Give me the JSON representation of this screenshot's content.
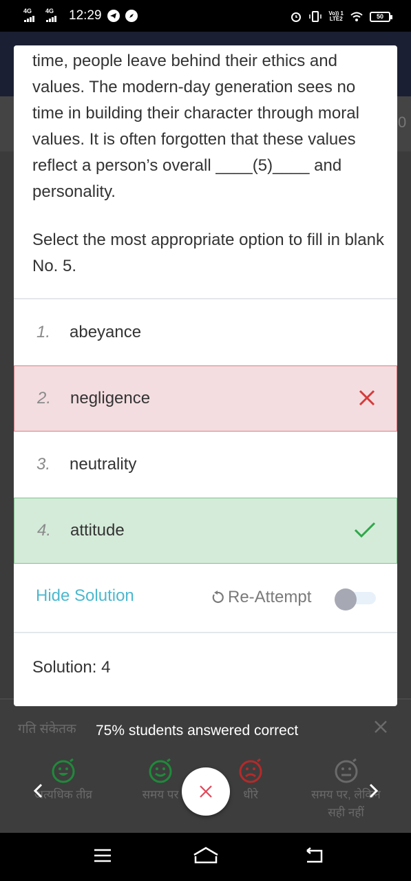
{
  "status_bar": {
    "network1": "4G",
    "network2": "4G",
    "time": "12:29",
    "lte_line1": "Vo)) 1",
    "lte_line2": "LTE2",
    "battery": "50"
  },
  "background": {
    "partial_number": "0",
    "speed_title": "गति संकेतक",
    "speed_options": [
      {
        "label": "अत्यधिक तीव्र",
        "color": "#1f8a3a"
      },
      {
        "label": "समय पर",
        "color": "#1f8a3a"
      },
      {
        "label": "धीरे",
        "color": "#b52a2a"
      },
      {
        "label": "समय पर, लेकिन सही नहीं",
        "color": "#6a6a6a"
      }
    ]
  },
  "modal": {
    "passage": "time, people leave behind their ethics and values. The modern-day generation sees no time in building their character through moral values. It is often forgotten that these values reflect a person’s overall ____(5)____ and personality.",
    "question": "Select the most appropriate option to fill in blank No. 5.",
    "options": [
      {
        "number": "1.",
        "text": "abeyance",
        "state": "neutral"
      },
      {
        "number": "2.",
        "text": "negligence",
        "state": "wrong"
      },
      {
        "number": "3.",
        "text": "neutrality",
        "state": "neutral"
      },
      {
        "number": "4.",
        "text": "attitude",
        "state": "correct"
      }
    ],
    "hide_solution_label": "Hide Solution",
    "reattempt_label": "Re-Attempt",
    "reattempt_toggle_on": false,
    "solution_text": "Solution: 4"
  },
  "toast": "75% students answered correct",
  "colors": {
    "accent": "#4cb8cf",
    "wrong_bg": "#f3dde0",
    "wrong_border": "#e27a7e",
    "wrong_mark": "#d63a3a",
    "correct_bg": "#d5ebd9",
    "correct_border": "#7cc48d",
    "correct_mark": "#2ea84a"
  },
  "icons": {
    "wrong_mark": "close-icon",
    "correct_mark": "check-icon",
    "reattempt": "refresh-icon",
    "fab": "close-icon",
    "prev": "chevron-left-icon",
    "next": "chevron-right-icon"
  }
}
